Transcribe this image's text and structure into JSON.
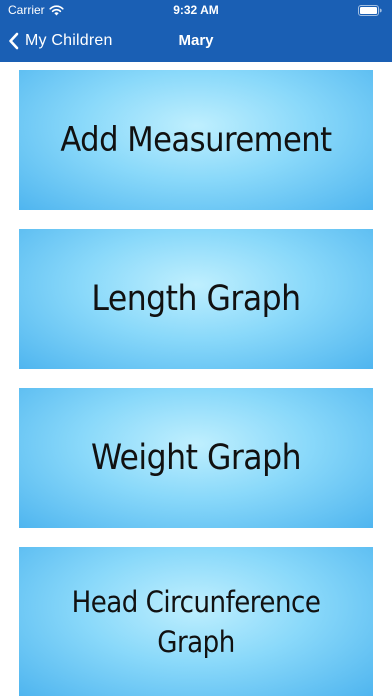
{
  "status_bar": {
    "carrier": "Carrier",
    "time": "9:32 AM",
    "wifi_icon": "wifi-icon",
    "battery_icon": "battery-icon"
  },
  "nav": {
    "back_label": "My Children",
    "back_icon": "chevron-left-icon",
    "title": "Mary"
  },
  "colors": {
    "nav_background": "#1a5fb4",
    "card_light": "#bfeffe",
    "card_dark": "#4fb5ef",
    "text": "#111111"
  },
  "menu": {
    "items": [
      {
        "label": "Add Measurement"
      },
      {
        "label": "Length Graph"
      },
      {
        "label": "Weight Graph"
      },
      {
        "label": "Head Circunference Graph"
      }
    ]
  }
}
